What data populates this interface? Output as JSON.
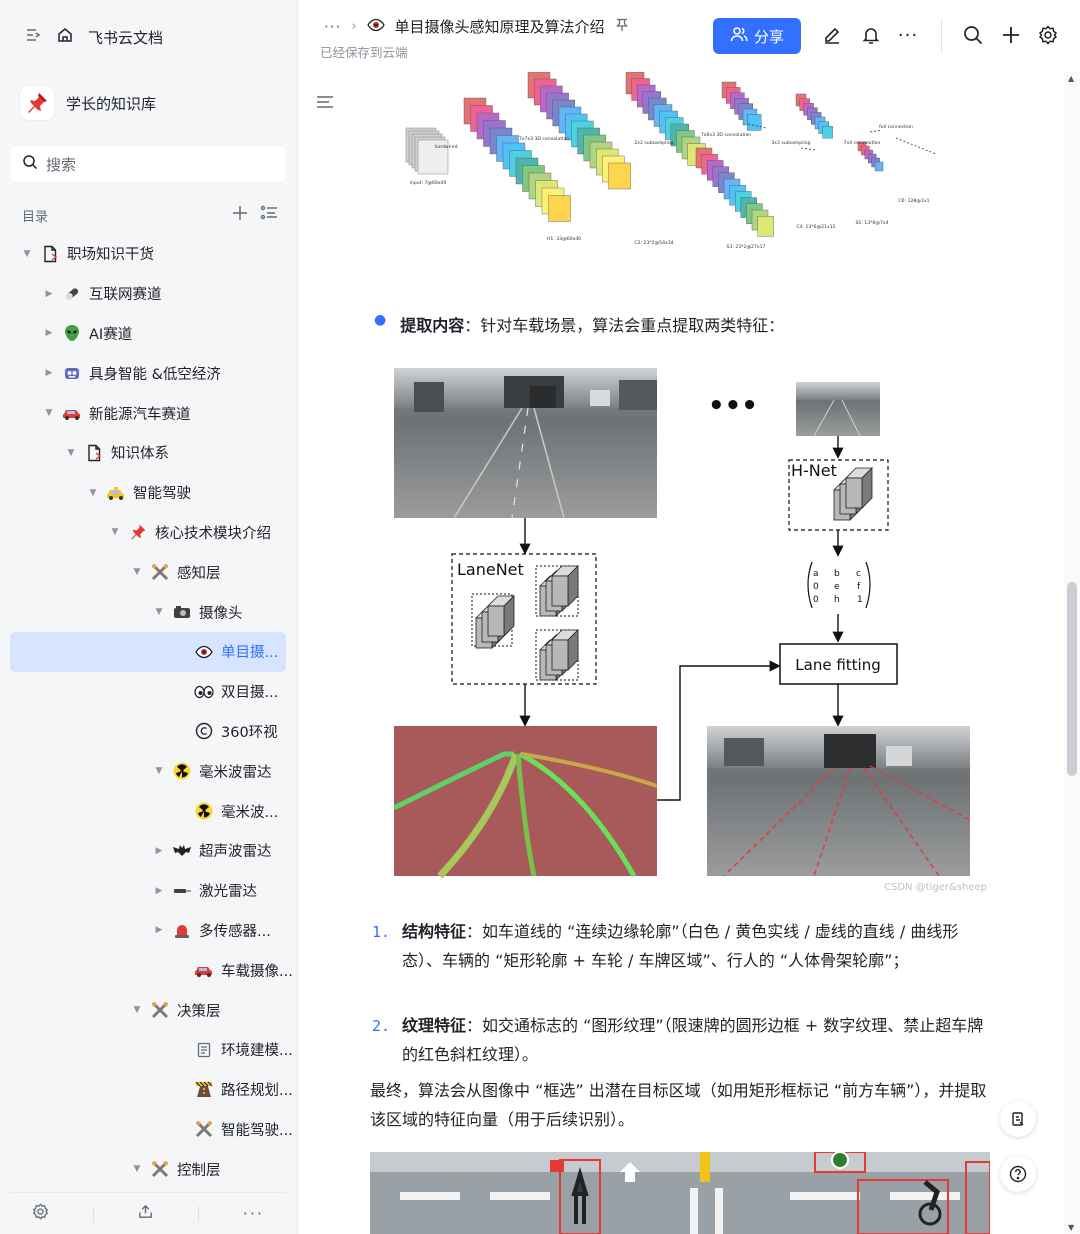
{
  "sidebar": {
    "app_name": "飞书云文档",
    "kb_name": "学长的知识库",
    "search_placeholder": "搜索",
    "toc_label": "目录",
    "tree": [
      {
        "label": "职场知识干货",
        "level": 0,
        "caret": "down",
        "icon": "doc-icon"
      },
      {
        "label": "互联网赛道",
        "level": 1,
        "caret": "right",
        "icon": "pill-icon"
      },
      {
        "label": "AI赛道",
        "level": 1,
        "caret": "right",
        "icon": "alien-icon"
      },
      {
        "label": "具身智能 &低空经济",
        "level": 1,
        "caret": "right",
        "icon": "robot-icon"
      },
      {
        "label": "新能源汽车赛道",
        "level": 1,
        "caret": "down",
        "icon": "car-icon"
      },
      {
        "label": "知识体系",
        "level": 2,
        "caret": "down",
        "icon": "doc-icon"
      },
      {
        "label": "智能驾驶",
        "level": 3,
        "caret": "down",
        "icon": "taxi-icon"
      },
      {
        "label": "核心技术模块介绍",
        "level": 4,
        "caret": "down",
        "icon": "pin-icon"
      },
      {
        "label": "感知层",
        "level": 5,
        "caret": "down",
        "icon": "tools-icon"
      },
      {
        "label": "摄像头",
        "level": 6,
        "caret": "down",
        "icon": "camera-icon"
      },
      {
        "label": "单目摄...",
        "level": 7,
        "caret": "none",
        "icon": "eye-icon",
        "active": true
      },
      {
        "label": "双目摄...",
        "level": 7,
        "caret": "none",
        "icon": "eyes-icon"
      },
      {
        "label": "360环视",
        "level": 7,
        "caret": "none",
        "icon": "copyright-icon"
      },
      {
        "label": "毫米波雷达",
        "level": 6,
        "caret": "down",
        "icon": "radioactive-icon"
      },
      {
        "label": "毫米波...",
        "level": 7,
        "caret": "none",
        "icon": "radioactive-icon"
      },
      {
        "label": "超声波雷达",
        "level": 6,
        "caret": "right",
        "icon": "bat-icon"
      },
      {
        "label": "激光雷达",
        "level": 6,
        "caret": "right",
        "icon": "laser-icon"
      },
      {
        "label": "多传感器...",
        "level": 6,
        "caret": "right",
        "icon": "siren-icon"
      },
      {
        "label": "车载摄像...",
        "level": 7,
        "caret": "none",
        "icon": "car-icon"
      },
      {
        "label": "决策层",
        "level": 5,
        "caret": "down",
        "icon": "tools-icon"
      },
      {
        "label": "环境建模...",
        "level": 7,
        "caret": "none",
        "icon": "page-icon"
      },
      {
        "label": "路径规划...",
        "level": 7,
        "caret": "none",
        "icon": "road-icon"
      },
      {
        "label": "智能驾驶...",
        "level": 7,
        "caret": "none",
        "icon": "tools-icon"
      },
      {
        "label": "控制层",
        "level": 5,
        "caret": "down",
        "icon": "tools-icon"
      }
    ]
  },
  "header": {
    "doc_title": "单目摄像头感知原理及算法介绍",
    "saved_status": "已经保存到云端",
    "share_label": "分享"
  },
  "content": {
    "cnn_labels": [
      "input: 7@60x40",
      "hardwired",
      "H1: 33@60x40",
      "7x7x3 3D convolution",
      "C2: 23*2@54x34",
      "2x2 subsampling",
      "7x6x3 3D convolution",
      "S3: 23*2@27x17",
      "3x3 subsampling",
      "C4: 13*6@21x12",
      "7x4 convolution",
      "S5: 13*6@7x4",
      "full connection",
      "C6: 128@1x1"
    ],
    "bullet_bold": "提取内容",
    "bullet_text": "：针对车载场景，算法会重点提取两类特征：",
    "figure": {
      "lanenet": "LaneNet",
      "hnet": "H-Net",
      "lane_fitting": "Lane fitting",
      "matrix": [
        [
          "a",
          "b",
          "c"
        ],
        [
          "0",
          "e",
          "f"
        ],
        [
          "0",
          "h",
          "1"
        ]
      ],
      "ellipsis": "•••"
    },
    "watermark": "CSDN @tiger&sheep",
    "list": [
      {
        "num": "1.",
        "bold": "结构特征",
        "text": "：如车道线的 “连续边缘轮廓”（白色 / 黄色实线 / 虚线的直线 / 曲线形态）、车辆的 “矩形轮廓 + 车轮 / 车牌区域”、行人的 “人体骨架轮廓”；"
      },
      {
        "num": "2.",
        "bold": "纹理特征",
        "text": "：如交通标志的 “图形纹理”（限速牌的圆形边框 + 数字纹理、禁止超车牌的红色斜杠纹理）。"
      }
    ],
    "paragraph": "最终，算法会从图像中 “框选” 出潜在目标区域（如用矩形框标记 “前方车辆”），并提取该区域的特征向量（用于后续识别）。"
  },
  "colors": {
    "accent": "#3370ff",
    "active_bg": "#d6e4ff",
    "sidebar_bg": "#f5f6f7"
  }
}
